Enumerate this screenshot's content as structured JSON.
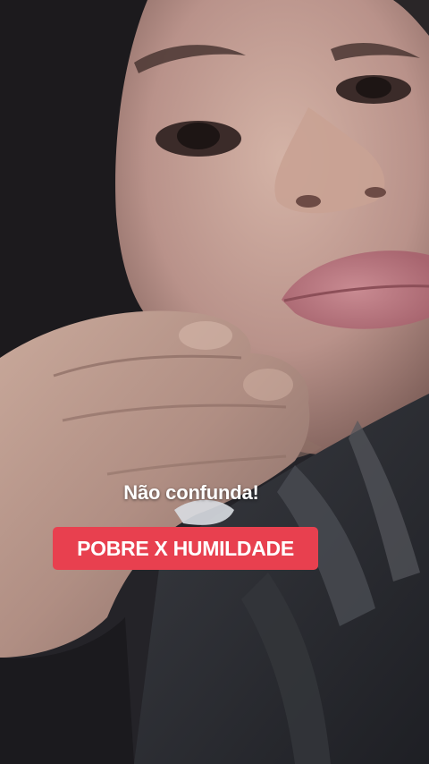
{
  "story": {
    "caption_line1": "Não confunda!",
    "caption_line2": "POBRE X HUMILDADE",
    "caption_box_color": "#e8404f",
    "caption_text_color": "#ffffff"
  }
}
